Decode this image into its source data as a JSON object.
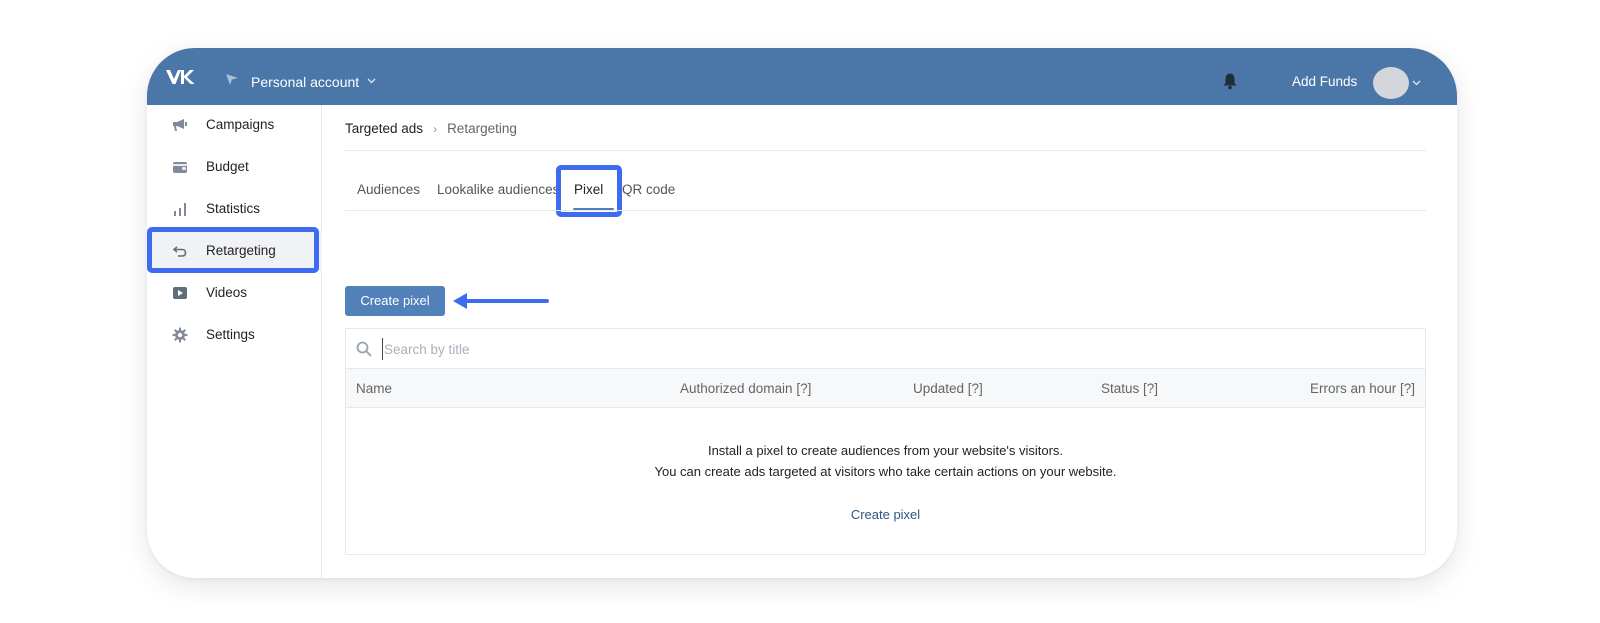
{
  "header": {
    "account_label": "Personal account",
    "add_funds": "Add Funds",
    "brand_color": "#4a76a8"
  },
  "sidebar": {
    "items": [
      {
        "label": "Campaigns",
        "icon": "megaphone-icon"
      },
      {
        "label": "Budget",
        "icon": "wallet-icon"
      },
      {
        "label": "Statistics",
        "icon": "bar-chart-icon"
      },
      {
        "label": "Retargeting",
        "icon": "retarget-arrow-icon",
        "active": true
      },
      {
        "label": "Videos",
        "icon": "video-play-icon"
      },
      {
        "label": "Settings",
        "icon": "gear-icon"
      }
    ]
  },
  "breadcrumb": {
    "items": [
      "Targeted ads",
      "Retargeting"
    ],
    "separator": "›"
  },
  "tabs": [
    {
      "label": "Audiences"
    },
    {
      "label": "Lookalike audiences"
    },
    {
      "label": "Pixel",
      "active": true
    },
    {
      "label": "QR code"
    }
  ],
  "actions": {
    "create_pixel": "Create pixel"
  },
  "search": {
    "placeholder": "Search by title",
    "value": ""
  },
  "table": {
    "columns": [
      "Name",
      "Authorized domain [?]",
      "Updated [?]",
      "Status [?]",
      "Errors an hour [?]"
    ]
  },
  "empty_state": {
    "line1": "Install a pixel to create audiences from your website's visitors.",
    "line2": "You can create ads targeted at visitors who take certain actions on your website.",
    "link": "Create pixel"
  },
  "colors": {
    "accent": "#5181b8",
    "highlight": "#3d6cf0",
    "link": "#2a5885"
  }
}
